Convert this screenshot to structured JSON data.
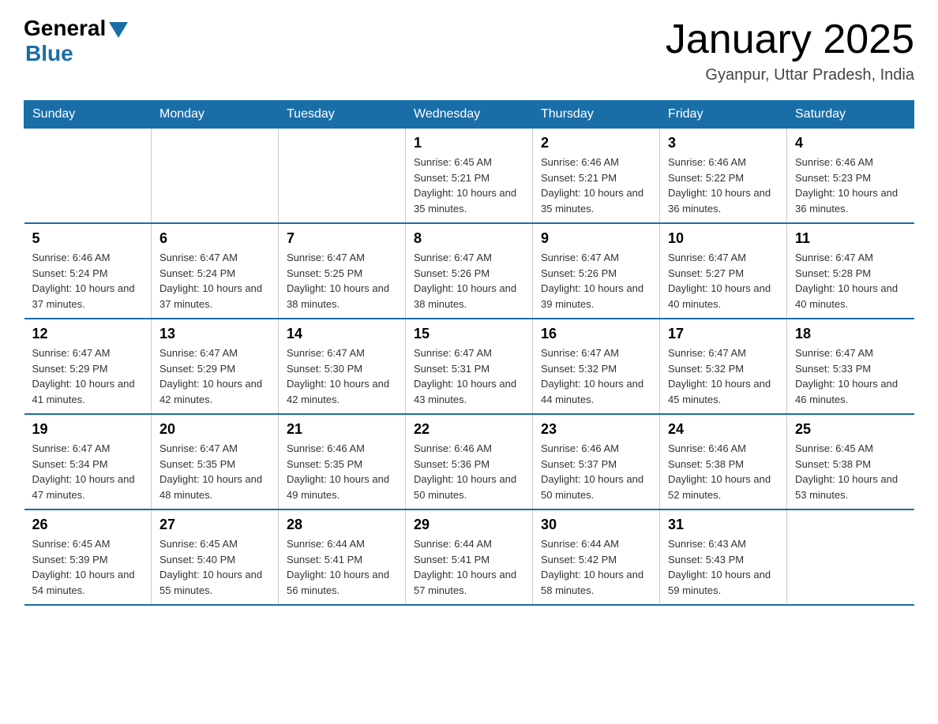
{
  "logo": {
    "general_text": "General",
    "blue_text": "Blue"
  },
  "title": "January 2025",
  "subtitle": "Gyanpur, Uttar Pradesh, India",
  "days_of_week": [
    "Sunday",
    "Monday",
    "Tuesday",
    "Wednesday",
    "Thursday",
    "Friday",
    "Saturday"
  ],
  "weeks": [
    [
      {
        "day": "",
        "info": ""
      },
      {
        "day": "",
        "info": ""
      },
      {
        "day": "",
        "info": ""
      },
      {
        "day": "1",
        "info": "Sunrise: 6:45 AM\nSunset: 5:21 PM\nDaylight: 10 hours and 35 minutes."
      },
      {
        "day": "2",
        "info": "Sunrise: 6:46 AM\nSunset: 5:21 PM\nDaylight: 10 hours and 35 minutes."
      },
      {
        "day": "3",
        "info": "Sunrise: 6:46 AM\nSunset: 5:22 PM\nDaylight: 10 hours and 36 minutes."
      },
      {
        "day": "4",
        "info": "Sunrise: 6:46 AM\nSunset: 5:23 PM\nDaylight: 10 hours and 36 minutes."
      }
    ],
    [
      {
        "day": "5",
        "info": "Sunrise: 6:46 AM\nSunset: 5:24 PM\nDaylight: 10 hours and 37 minutes."
      },
      {
        "day": "6",
        "info": "Sunrise: 6:47 AM\nSunset: 5:24 PM\nDaylight: 10 hours and 37 minutes."
      },
      {
        "day": "7",
        "info": "Sunrise: 6:47 AM\nSunset: 5:25 PM\nDaylight: 10 hours and 38 minutes."
      },
      {
        "day": "8",
        "info": "Sunrise: 6:47 AM\nSunset: 5:26 PM\nDaylight: 10 hours and 38 minutes."
      },
      {
        "day": "9",
        "info": "Sunrise: 6:47 AM\nSunset: 5:26 PM\nDaylight: 10 hours and 39 minutes."
      },
      {
        "day": "10",
        "info": "Sunrise: 6:47 AM\nSunset: 5:27 PM\nDaylight: 10 hours and 40 minutes."
      },
      {
        "day": "11",
        "info": "Sunrise: 6:47 AM\nSunset: 5:28 PM\nDaylight: 10 hours and 40 minutes."
      }
    ],
    [
      {
        "day": "12",
        "info": "Sunrise: 6:47 AM\nSunset: 5:29 PM\nDaylight: 10 hours and 41 minutes."
      },
      {
        "day": "13",
        "info": "Sunrise: 6:47 AM\nSunset: 5:29 PM\nDaylight: 10 hours and 42 minutes."
      },
      {
        "day": "14",
        "info": "Sunrise: 6:47 AM\nSunset: 5:30 PM\nDaylight: 10 hours and 42 minutes."
      },
      {
        "day": "15",
        "info": "Sunrise: 6:47 AM\nSunset: 5:31 PM\nDaylight: 10 hours and 43 minutes."
      },
      {
        "day": "16",
        "info": "Sunrise: 6:47 AM\nSunset: 5:32 PM\nDaylight: 10 hours and 44 minutes."
      },
      {
        "day": "17",
        "info": "Sunrise: 6:47 AM\nSunset: 5:32 PM\nDaylight: 10 hours and 45 minutes."
      },
      {
        "day": "18",
        "info": "Sunrise: 6:47 AM\nSunset: 5:33 PM\nDaylight: 10 hours and 46 minutes."
      }
    ],
    [
      {
        "day": "19",
        "info": "Sunrise: 6:47 AM\nSunset: 5:34 PM\nDaylight: 10 hours and 47 minutes."
      },
      {
        "day": "20",
        "info": "Sunrise: 6:47 AM\nSunset: 5:35 PM\nDaylight: 10 hours and 48 minutes."
      },
      {
        "day": "21",
        "info": "Sunrise: 6:46 AM\nSunset: 5:35 PM\nDaylight: 10 hours and 49 minutes."
      },
      {
        "day": "22",
        "info": "Sunrise: 6:46 AM\nSunset: 5:36 PM\nDaylight: 10 hours and 50 minutes."
      },
      {
        "day": "23",
        "info": "Sunrise: 6:46 AM\nSunset: 5:37 PM\nDaylight: 10 hours and 50 minutes."
      },
      {
        "day": "24",
        "info": "Sunrise: 6:46 AM\nSunset: 5:38 PM\nDaylight: 10 hours and 52 minutes."
      },
      {
        "day": "25",
        "info": "Sunrise: 6:45 AM\nSunset: 5:38 PM\nDaylight: 10 hours and 53 minutes."
      }
    ],
    [
      {
        "day": "26",
        "info": "Sunrise: 6:45 AM\nSunset: 5:39 PM\nDaylight: 10 hours and 54 minutes."
      },
      {
        "day": "27",
        "info": "Sunrise: 6:45 AM\nSunset: 5:40 PM\nDaylight: 10 hours and 55 minutes."
      },
      {
        "day": "28",
        "info": "Sunrise: 6:44 AM\nSunset: 5:41 PM\nDaylight: 10 hours and 56 minutes."
      },
      {
        "day": "29",
        "info": "Sunrise: 6:44 AM\nSunset: 5:41 PM\nDaylight: 10 hours and 57 minutes."
      },
      {
        "day": "30",
        "info": "Sunrise: 6:44 AM\nSunset: 5:42 PM\nDaylight: 10 hours and 58 minutes."
      },
      {
        "day": "31",
        "info": "Sunrise: 6:43 AM\nSunset: 5:43 PM\nDaylight: 10 hours and 59 minutes."
      },
      {
        "day": "",
        "info": ""
      }
    ]
  ]
}
